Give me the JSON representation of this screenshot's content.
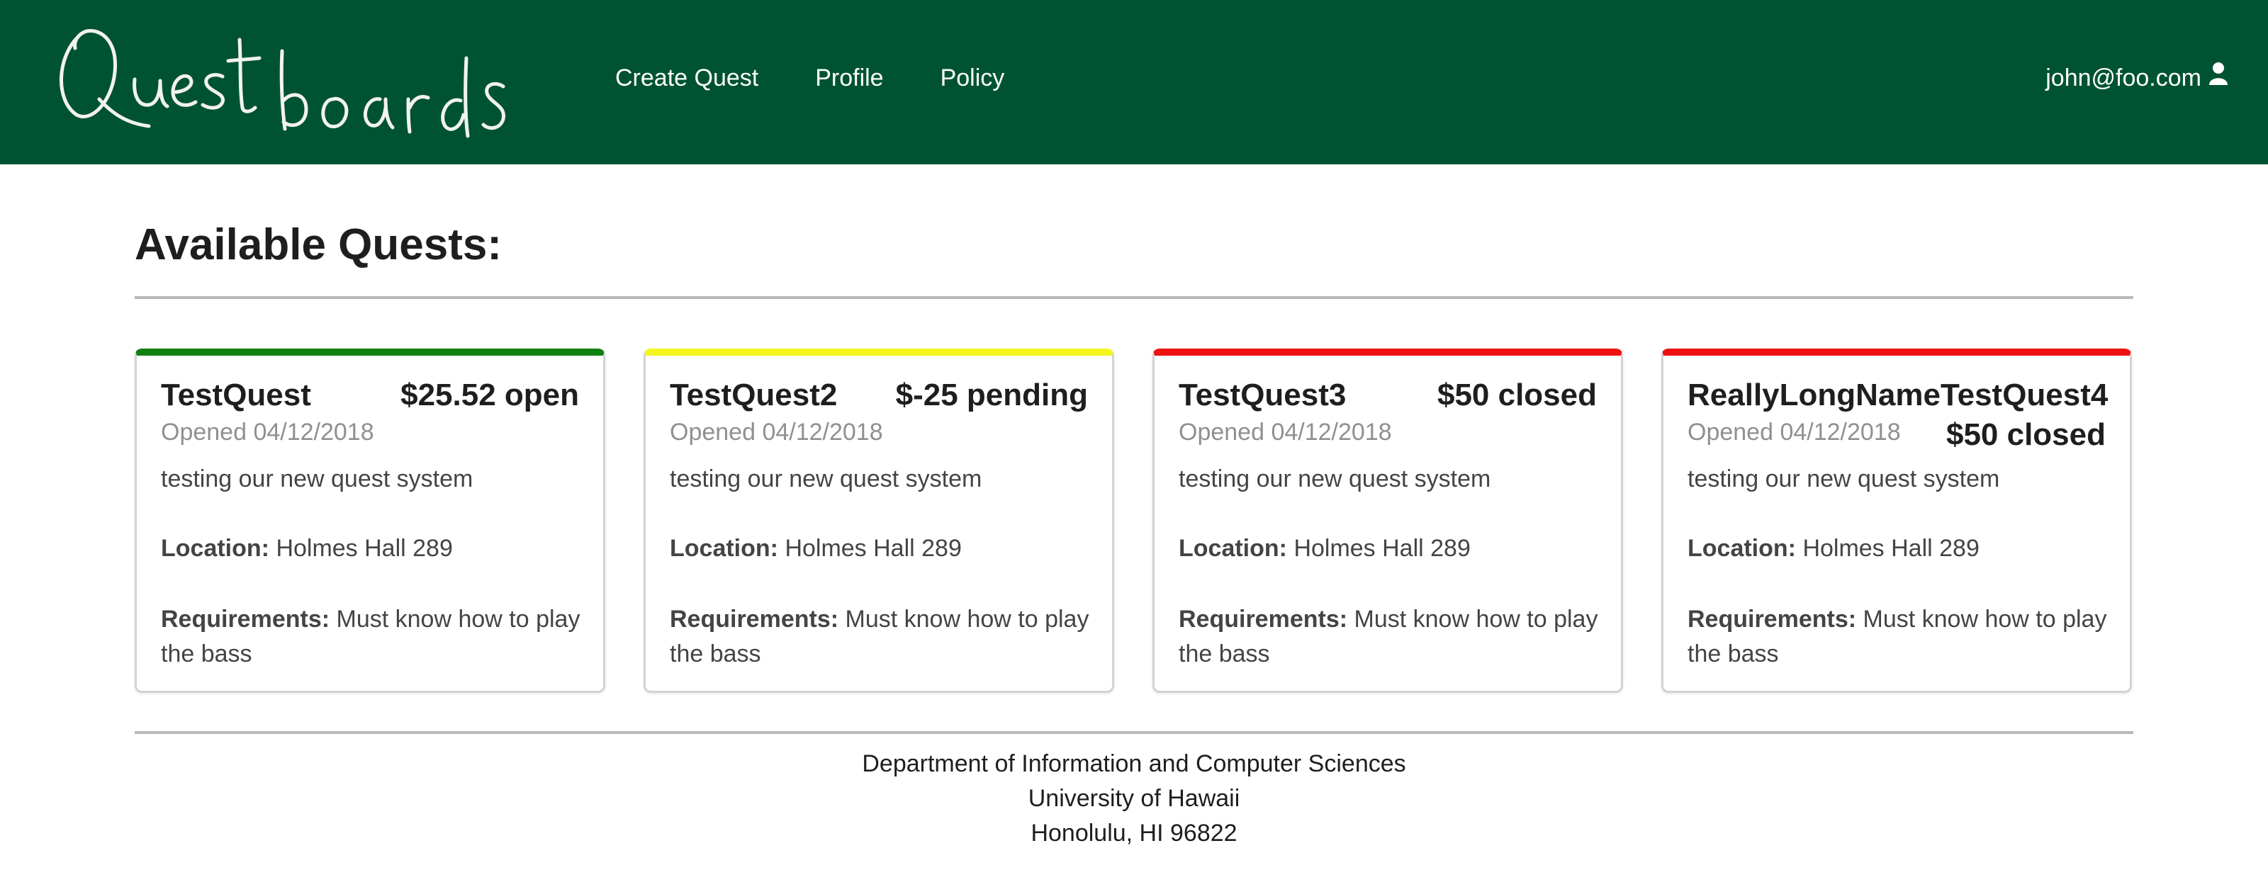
{
  "nav": {
    "logo_text": "Questboards",
    "links": [
      "Create Quest",
      "Profile",
      "Policy"
    ],
    "user_email": "john@foo.com",
    "user_icon": "user-icon",
    "bg_color": "#005332"
  },
  "main": {
    "heading": "Available Quests:",
    "location_label": "Location:",
    "requirements_label": "Requirements:",
    "quests": [
      {
        "title": "TestQuest",
        "status": "$25.52 open",
        "date": "Opened 04/12/2018",
        "description": "testing our new quest system",
        "location": "Holmes Hall 289",
        "requirements": "Must know how to play the bass",
        "accent": "#0f800f"
      },
      {
        "title": "TestQuest2",
        "status": "$-25 pending",
        "date": "Opened 04/12/2018",
        "description": "testing our new quest system",
        "location": "Holmes Hall 289",
        "requirements": "Must know how to play the bass",
        "accent": "#f5f51e"
      },
      {
        "title": "TestQuest3",
        "status": "$50 closed",
        "date": "Opened 04/12/2018",
        "description": "testing our new quest system",
        "location": "Holmes Hall 289",
        "requirements": "Must know how to play the bass",
        "accent": "#ee1111"
      },
      {
        "title": "ReallyLongNameTestQuest4",
        "status": "$50 closed",
        "date": "Opened 04/12/2018",
        "description": "testing our new quest system",
        "location": "Holmes Hall 289",
        "requirements": "Must know how to play the bass",
        "accent": "#ee1111"
      }
    ]
  },
  "footer": {
    "line1": "Department of Information and Computer Sciences",
    "line2": "University of Hawaii",
    "line3": "Honolulu, HI 96822"
  }
}
